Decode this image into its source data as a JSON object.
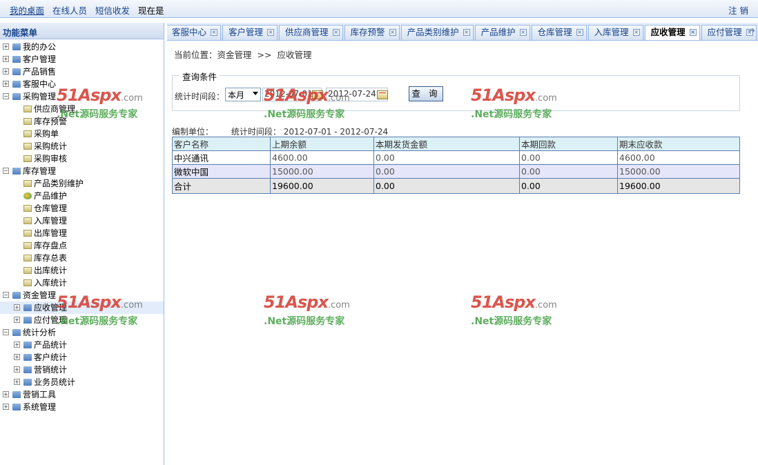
{
  "topbar": {
    "nav": [
      "我的桌面",
      "在线人员",
      "短信收发",
      "现在是"
    ],
    "logout": "注 销"
  },
  "sidebar": {
    "title": "功能菜单",
    "items": [
      {
        "label": "我的办公",
        "level": 0,
        "expander": "plus",
        "icon": "folder"
      },
      {
        "label": "客户管理",
        "level": 0,
        "expander": "plus",
        "icon": "folder"
      },
      {
        "label": "产品销售",
        "level": 0,
        "expander": "plus",
        "icon": "folder"
      },
      {
        "label": "客服中心",
        "level": 0,
        "expander": "plus",
        "icon": "folder"
      },
      {
        "label": "采购管理",
        "level": 0,
        "expander": "minus",
        "icon": "folder"
      },
      {
        "label": "供应商管理",
        "level": 1,
        "expander": "",
        "icon": "page"
      },
      {
        "label": "库存预警",
        "level": 1,
        "expander": "",
        "icon": "page"
      },
      {
        "label": "采购单",
        "level": 1,
        "expander": "",
        "icon": "page"
      },
      {
        "label": "采购统计",
        "level": 1,
        "expander": "",
        "icon": "page"
      },
      {
        "label": "采购审核",
        "level": 1,
        "expander": "",
        "icon": "page"
      },
      {
        "label": "库存管理",
        "level": 0,
        "expander": "minus",
        "icon": "folder"
      },
      {
        "label": "产品类别维护",
        "level": 1,
        "expander": "",
        "icon": "page"
      },
      {
        "label": "产品维护",
        "level": 1,
        "expander": "",
        "icon": "special"
      },
      {
        "label": "仓库管理",
        "level": 1,
        "expander": "",
        "icon": "page"
      },
      {
        "label": "入库管理",
        "level": 1,
        "expander": "",
        "icon": "page"
      },
      {
        "label": "出库管理",
        "level": 1,
        "expander": "",
        "icon": "page"
      },
      {
        "label": "库存盘点",
        "level": 1,
        "expander": "",
        "icon": "page"
      },
      {
        "label": "库存总表",
        "level": 1,
        "expander": "",
        "icon": "page"
      },
      {
        "label": "出库统计",
        "level": 1,
        "expander": "",
        "icon": "page"
      },
      {
        "label": "入库统计",
        "level": 1,
        "expander": "",
        "icon": "page"
      },
      {
        "label": "资金管理",
        "level": 0,
        "expander": "minus",
        "icon": "folder"
      },
      {
        "label": "应收管理",
        "level": 1,
        "expander": "plus",
        "icon": "folder",
        "selected": true
      },
      {
        "label": "应付管理",
        "level": 1,
        "expander": "plus",
        "icon": "folder"
      },
      {
        "label": "统计分析",
        "level": 0,
        "expander": "minus",
        "icon": "folder"
      },
      {
        "label": "产品统计",
        "level": 1,
        "expander": "plus",
        "icon": "folder"
      },
      {
        "label": "客户统计",
        "level": 1,
        "expander": "plus",
        "icon": "folder"
      },
      {
        "label": "营销统计",
        "level": 1,
        "expander": "plus",
        "icon": "folder"
      },
      {
        "label": "业务员统计",
        "level": 1,
        "expander": "plus",
        "icon": "folder"
      },
      {
        "label": "营销工具",
        "level": 0,
        "expander": "plus",
        "icon": "folder"
      },
      {
        "label": "系统管理",
        "level": 0,
        "expander": "plus",
        "icon": "folder"
      }
    ]
  },
  "tabs": [
    {
      "label": "客服中心",
      "active": false
    },
    {
      "label": "客户管理",
      "active": false
    },
    {
      "label": "供应商管理",
      "active": false
    },
    {
      "label": "库存预警",
      "active": false
    },
    {
      "label": "产品类别维护",
      "active": false
    },
    {
      "label": "产品维护",
      "active": false
    },
    {
      "label": "仓库管理",
      "active": false
    },
    {
      "label": "入库管理",
      "active": false
    },
    {
      "label": "应收管理",
      "active": true
    },
    {
      "label": "应付管理",
      "active": false
    }
  ],
  "main": {
    "breadcrumb": {
      "prefix": "当前位置：资金管理",
      "sep": ">>",
      "current": "应收管理"
    },
    "query": {
      "legend": "查询条件",
      "period_label": "统计时间段：",
      "period_value": "本月",
      "date_from": "2012-07-01",
      "date_to": "2012-07-24",
      "button": "查 询"
    },
    "report": {
      "unit_label": "编制单位：",
      "period_label": "统计时间段：",
      "period_range": "2012-07-01 - 2012-07-24",
      "columns": [
        "客户名称",
        "上期余额",
        "本期发货金额",
        "本期回款",
        "期末应收款"
      ],
      "rows": [
        [
          "中兴通讯",
          "4600.00",
          "0.00",
          "0.00",
          "4600.00"
        ],
        [
          "微软中国",
          "15000.00",
          "0.00",
          "0.00",
          "15000.00"
        ]
      ],
      "total": [
        "合计",
        "19600.00",
        "0.00",
        "0.00",
        "19600.00"
      ]
    }
  },
  "watermark": {
    "brand": "51Aspx",
    "domain": ".com",
    "tagline": ".Net源码服务专家"
  }
}
